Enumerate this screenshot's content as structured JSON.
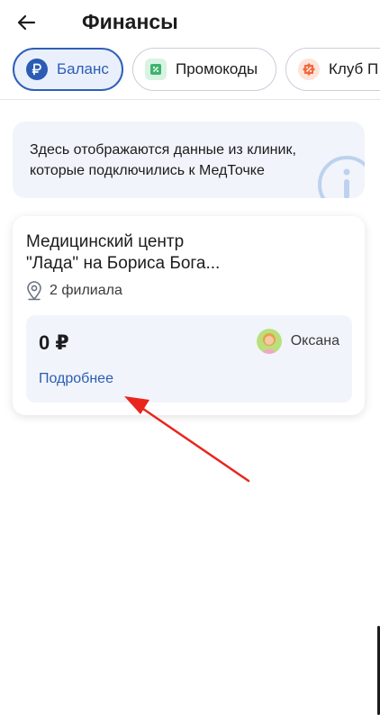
{
  "header": {
    "title": "Финансы"
  },
  "tabs": [
    {
      "label": "Баланс",
      "icon": "ruble-icon",
      "active": true
    },
    {
      "label": "Промокоды",
      "icon": "promo-ticket-icon",
      "active": false
    },
    {
      "label": "Клуб П",
      "icon": "percent-badge-icon",
      "active": false
    }
  ],
  "info": {
    "line1": "Здесь отображаются данные из клиник,",
    "line2": "которые подключились к МедТочке"
  },
  "clinic": {
    "name_line1": "Медицинский центр",
    "name_line2": "\"Лада\" на Бориса Бога...",
    "branches": "2 филиала",
    "balance": "0 ₽",
    "user_name": "Оксана",
    "details_link": "Подробнее"
  },
  "colors": {
    "accent": "#2a5cb5",
    "annotation": "#e8261c"
  }
}
